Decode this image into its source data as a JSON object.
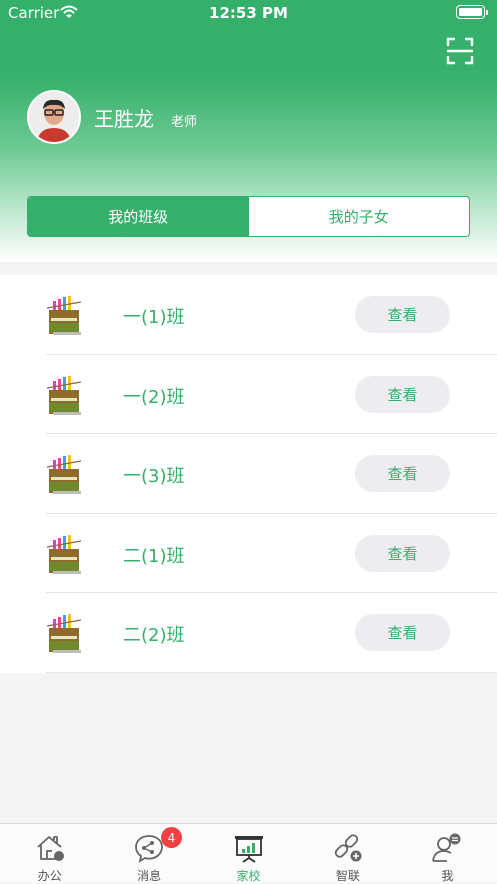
{
  "status_bar": {
    "carrier": "Carrier",
    "time": "12:53 PM"
  },
  "header": {
    "user_name": "王胜龙",
    "user_role": "老师",
    "scan_icon": "scan-icon",
    "colors": {
      "primary": "#34b06a"
    }
  },
  "segments": [
    {
      "label": "我的班级",
      "active": true
    },
    {
      "label": "我的子女",
      "active": false
    }
  ],
  "classes": [
    {
      "name": "一(1)班",
      "action": "查看"
    },
    {
      "name": "一(2)班",
      "action": "查看"
    },
    {
      "name": "一(3)班",
      "action": "查看"
    },
    {
      "name": "二(1)班",
      "action": "查看"
    },
    {
      "name": "二(2)班",
      "action": "查看"
    }
  ],
  "tabbar": {
    "items": [
      {
        "label": "办公",
        "icon": "office-home-icon"
      },
      {
        "label": "消息",
        "icon": "message-bubble-icon",
        "badge": "4"
      },
      {
        "label": "家校",
        "icon": "home-school-board-icon",
        "active": true
      },
      {
        "label": "智联",
        "icon": "link-plus-icon"
      },
      {
        "label": "我",
        "icon": "profile-icon"
      }
    ]
  }
}
